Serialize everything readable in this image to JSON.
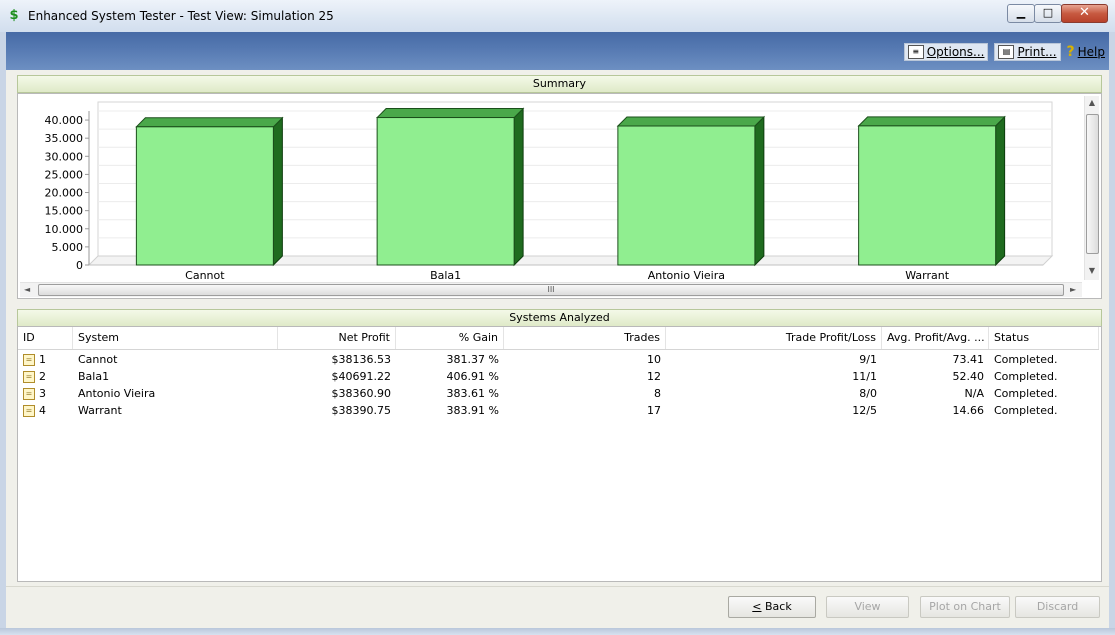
{
  "window": {
    "title": "Enhanced System Tester - Test View: Simulation 25",
    "app_icon": "$",
    "min_glyph": "▁",
    "max_glyph": "□",
    "close_glyph": "✕"
  },
  "toolbar": {
    "options_label": "Options...",
    "print_label": "Print...",
    "help_label": "Help",
    "help_glyph": "?"
  },
  "summary": {
    "header": "Summary",
    "scroll_thumb_grip": "III"
  },
  "chart_data": {
    "type": "bar",
    "categories": [
      "Cannot",
      "Bala1",
      "Antonio Vieira",
      "Warrant"
    ],
    "values": [
      38136.53,
      40691.22,
      38360.9,
      38390.75
    ],
    "y_ticks": [
      "0",
      "5.000",
      "10.000",
      "15.000",
      "20.000",
      "25.000",
      "30.000",
      "35.000",
      "40.000"
    ],
    "ylim": [
      0,
      42500
    ],
    "bar_color": "#90ee90",
    "bar_side_color": "#1f6b1f",
    "bar_top_color": "#4aa84a",
    "style": "3d"
  },
  "systems": {
    "header": "Systems Analyzed",
    "columns": [
      "ID",
      "System",
      "Net Profit",
      "% Gain",
      "Trades",
      "Trade Profit/Loss",
      "Avg. Profit/Avg. ...",
      "Status"
    ],
    "rows": [
      {
        "id": "1",
        "system": "Cannot",
        "net_profit": "$38136.53",
        "gain": "381.37 %",
        "trades": "10",
        "tpl": "9/1",
        "avg": "73.41",
        "status": "Completed."
      },
      {
        "id": "2",
        "system": "Bala1",
        "net_profit": "$40691.22",
        "gain": "406.91 %",
        "trades": "12",
        "tpl": "11/1",
        "avg": "52.40",
        "status": "Completed."
      },
      {
        "id": "3",
        "system": "Antonio Vieira",
        "net_profit": "$38360.90",
        "gain": "383.61 %",
        "trades": "8",
        "tpl": "8/0",
        "avg": "N/A",
        "status": "Completed."
      },
      {
        "id": "4",
        "system": "Warrant",
        "net_profit": "$38390.75",
        "gain": "383.91 %",
        "trades": "17",
        "tpl": "12/5",
        "avg": "14.66",
        "status": "Completed."
      }
    ]
  },
  "footer": {
    "back_label": "Back",
    "view_label": "View",
    "plot_label": "Plot on Chart",
    "discard_label": "Discard"
  }
}
